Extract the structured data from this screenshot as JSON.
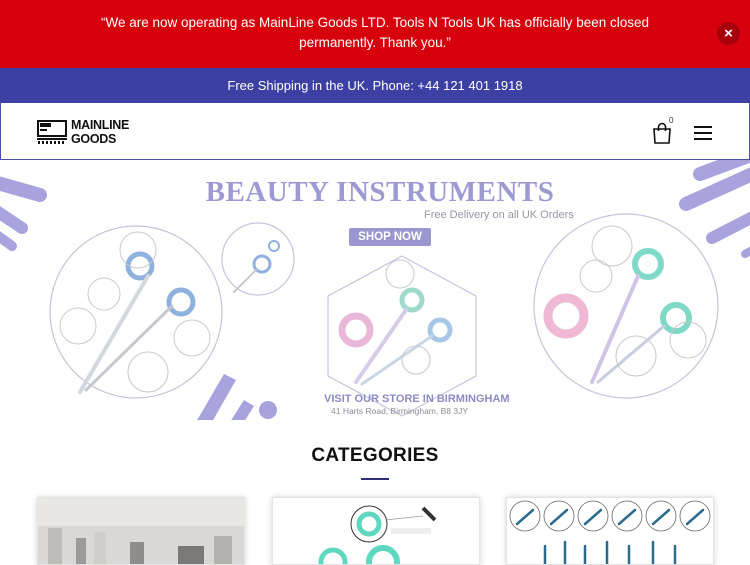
{
  "notice": {
    "text": "“We are now operating as MainLine Goods LTD. Tools N Tools UK has officially been closed permanently. Thank you.”",
    "close_label": "×"
  },
  "shipping_bar": {
    "text": "Free Shipping in the UK. Phone: +44 121 401 1918"
  },
  "header": {
    "logo_line1": "MAINLINE",
    "logo_line2": "GOODS",
    "cart_count": "0",
    "icons": [
      "shopping-bag-icon",
      "hamburger-menu-icon"
    ]
  },
  "hero": {
    "title": "BEAUTY INSTRUMENTS",
    "subtitle": "Free Delivery on all UK Orders",
    "cta_label": "SHOP NOW",
    "visit_text": "VISIT OUR STORE IN BIRMINGHAM",
    "address": "41 Harts Road, Birmingham, B8 3JY"
  },
  "categories": {
    "title": "CATEGORIES"
  },
  "colors": {
    "notice_bg": "#d7000d",
    "shipping_bg": "#3d40a3",
    "accent_lavender": "#9d9ad3",
    "underline": "#2e2e78"
  }
}
